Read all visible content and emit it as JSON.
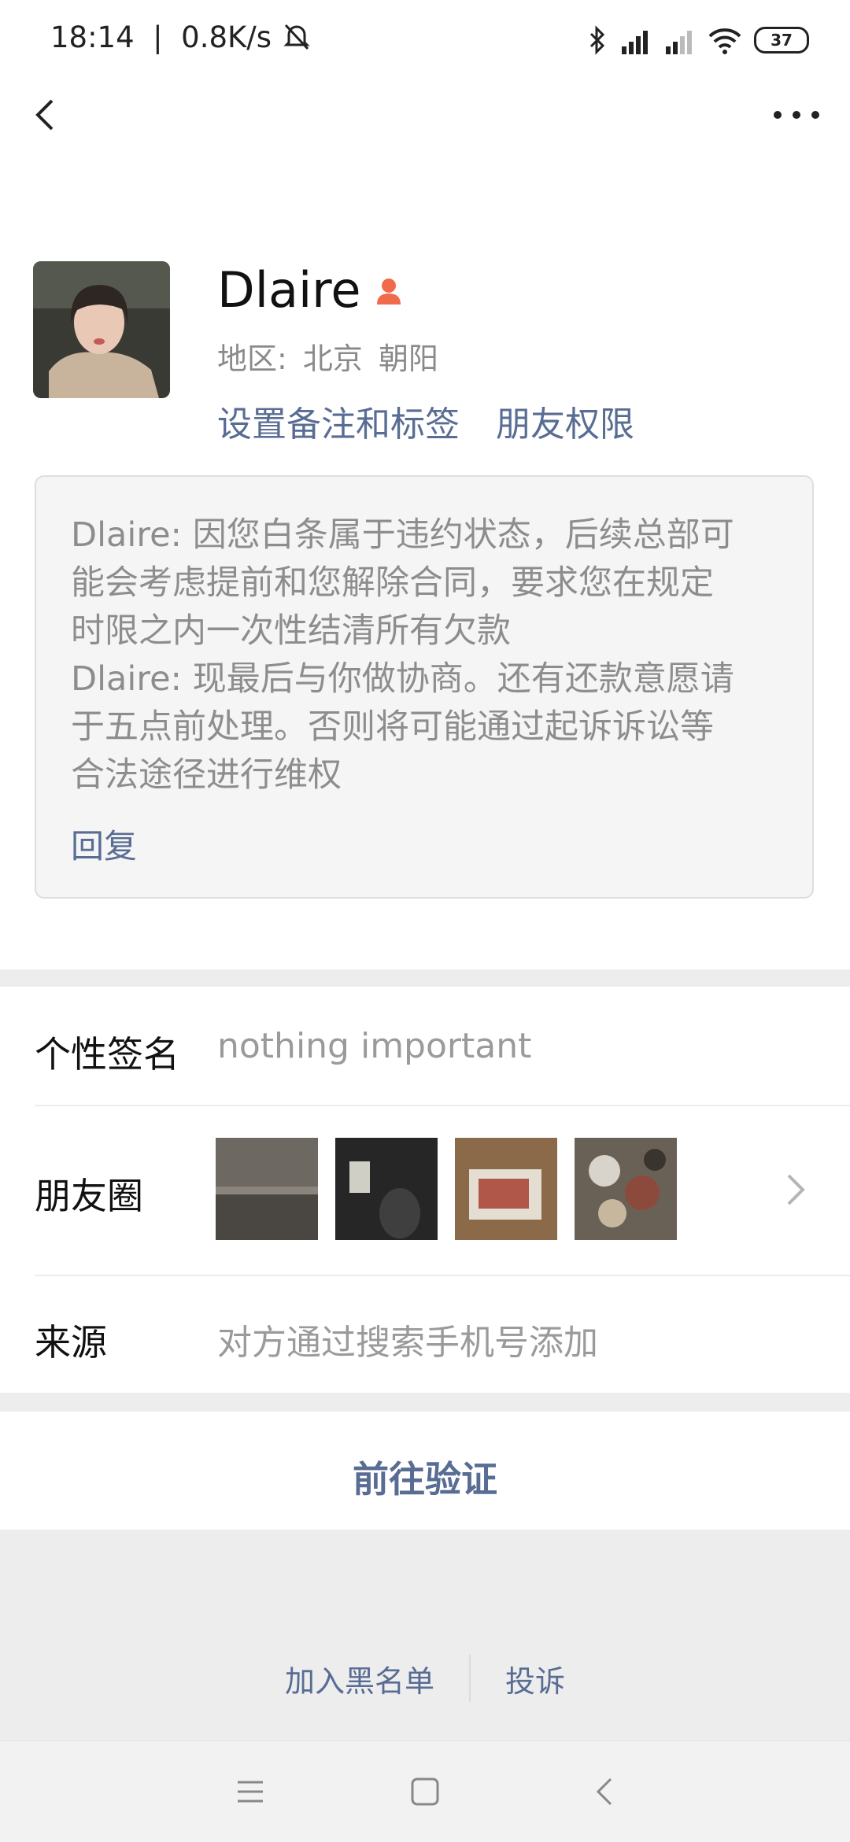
{
  "status": {
    "time": "18:14",
    "speed": "0.8K/s",
    "battery": "37"
  },
  "profile": {
    "name": "Dlaire",
    "region_label": "地区:",
    "region_city": "北京",
    "region_district": "朝阳",
    "link_remark": "设置备注和标签",
    "link_permission": "朋友权限"
  },
  "message": {
    "lines": [
      "Dlaire: 因您白条属于违约状态，后续总部可",
      "能会考虑提前和您解除合同，要求您在规定",
      "时限之内一次性结清所有欠款",
      "Dlaire: 现最后与你做协商。还有还款意愿请",
      "于五点前处理。否则将可能通过起诉诉讼等",
      "合法途径进行维权"
    ],
    "reply": "回复"
  },
  "info": {
    "signature_label": "个性签名",
    "signature_value": "nothing important",
    "moments_label": "朋友圈",
    "source_label": "来源",
    "source_value": "对方通过搜索手机号添加"
  },
  "actions": {
    "verify": "前往验证",
    "blacklist": "加入黑名单",
    "report": "投诉"
  },
  "colors": {
    "link": "#586c94",
    "gender_icon": "#f06a4c"
  }
}
